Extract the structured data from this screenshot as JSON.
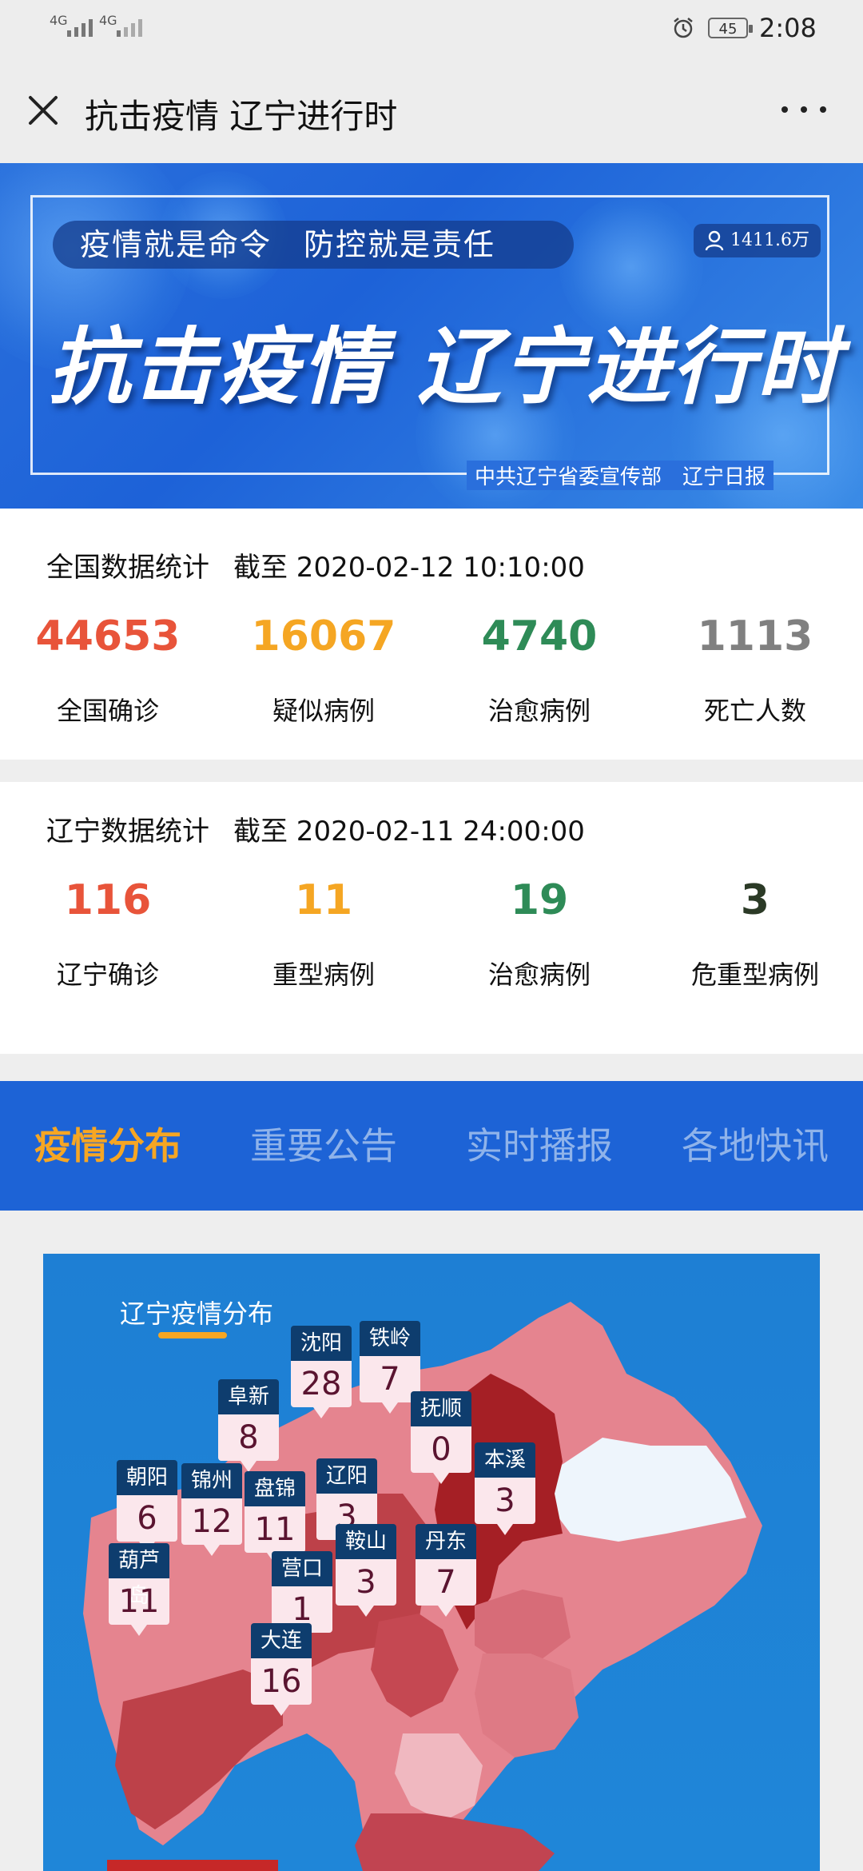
{
  "status_bar": {
    "net1": "4G",
    "net2": "4G",
    "battery": "45",
    "time": "2:08"
  },
  "nav": {
    "title": "抗击疫情 辽宁进行时"
  },
  "banner": {
    "slogan": "疫情就是命令　防控就是责任",
    "views": "1411.6万",
    "title": "抗击疫情 辽宁进行时",
    "publisher": "中共辽宁省委宣传部　辽宁日报"
  },
  "national": {
    "heading": "全国数据统计",
    "asof": "截至 2020-02-12 10:10:00",
    "items": [
      {
        "value": "44653",
        "label": "全国确诊",
        "color": "#e8543a"
      },
      {
        "value": "16067",
        "label": "疑似病例",
        "color": "#f5a623"
      },
      {
        "value": "4740",
        "label": "治愈病例",
        "color": "#2e8b57"
      },
      {
        "value": "1113",
        "label": "死亡人数",
        "color": "#808080"
      }
    ]
  },
  "liaoning": {
    "heading": "辽宁数据统计",
    "asof": "截至 2020-02-11 24:00:00",
    "items": [
      {
        "value": "116",
        "label": "辽宁确诊",
        "color": "#e8543a"
      },
      {
        "value": "11",
        "label": "重型病例",
        "color": "#f5a623"
      },
      {
        "value": "19",
        "label": "治愈病例",
        "color": "#2e8b57"
      },
      {
        "value": "3",
        "label": "危重型病例",
        "color": "#2b3a26"
      }
    ]
  },
  "tabs": [
    {
      "label": "疫情分布",
      "active": true
    },
    {
      "label": "重要公告",
      "active": false
    },
    {
      "label": "实时播报",
      "active": false
    },
    {
      "label": "各地快讯",
      "active": false
    }
  ],
  "map": {
    "title": "辽宁疫情分布",
    "cities": [
      {
        "name": "沈阳",
        "count": "28"
      },
      {
        "name": "铁岭",
        "count": "7"
      },
      {
        "name": "阜新",
        "count": "8"
      },
      {
        "name": "抚顺",
        "count": "0"
      },
      {
        "name": "朝阳",
        "count": "6"
      },
      {
        "name": "锦州",
        "count": "12"
      },
      {
        "name": "盘锦",
        "count": "11"
      },
      {
        "name": "辽阳",
        "count": "3"
      },
      {
        "name": "本溪",
        "count": "3"
      },
      {
        "name": "丹东",
        "count": "7"
      },
      {
        "name": "鞍山",
        "count": "3"
      },
      {
        "name": "葫芦岛",
        "count": "11"
      },
      {
        "name": "营口",
        "count": "1"
      },
      {
        "name": "大连",
        "count": "16"
      }
    ]
  }
}
